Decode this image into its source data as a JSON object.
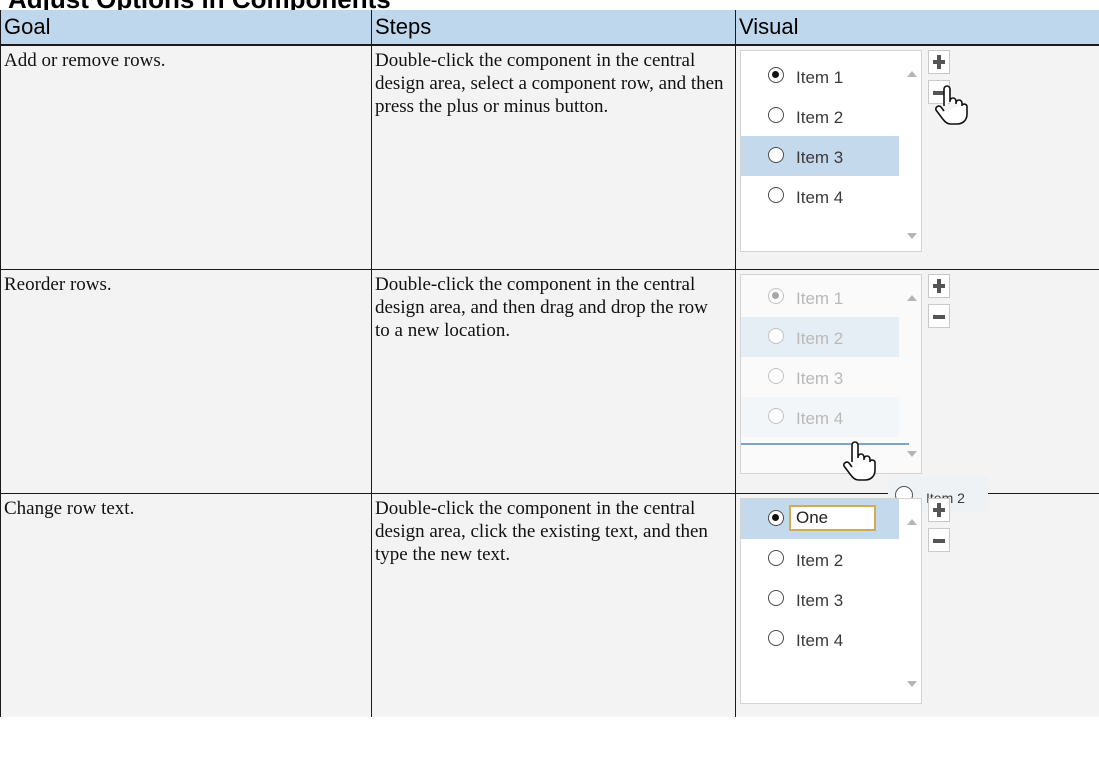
{
  "page_heading": "Adjust Options in Components",
  "table": {
    "headers": {
      "goal": "Goal",
      "steps": "Steps",
      "visual": "Visual"
    },
    "rows": [
      {
        "goal": "Add or remove rows.",
        "steps": "Double-click the component in the central design area, select a component row, and then press the plus or minus button.",
        "visual": {
          "items": [
            "Item 1",
            "Item 2",
            "Item 3",
            "Item 4"
          ],
          "selected_item": "Item 1",
          "highlighted_row": "Item 3"
        }
      },
      {
        "goal": "Reorder rows.",
        "steps": "Double-click the component in the central design area, and then drag and drop the row to a new location.",
        "visual": {
          "items": [
            "Item 1",
            "Item 2",
            "Item 3",
            "Item 4"
          ],
          "selected_item": "Item 1",
          "dragged_item": "Item 2"
        }
      },
      {
        "goal": "Change row text.",
        "steps": "Double-click the component in the central design area, click the existing text, and then type the new text.",
        "visual": {
          "edited_text": "One",
          "items": [
            "Item 2",
            "Item 3",
            "Item 4"
          ],
          "selected_item": "One"
        }
      }
    ]
  },
  "icons": [
    "radio-button-icon",
    "plus-icon",
    "minus-icon",
    "hand-pointer-icon",
    "scroll-up-arrow-icon",
    "scroll-down-arrow-icon"
  ],
  "colors": {
    "header_bg": "#bfd7ec",
    "cell_bg": "#f3f3f3",
    "row_highlight": "#c5d9ec",
    "edit_border": "#d8aa50"
  }
}
